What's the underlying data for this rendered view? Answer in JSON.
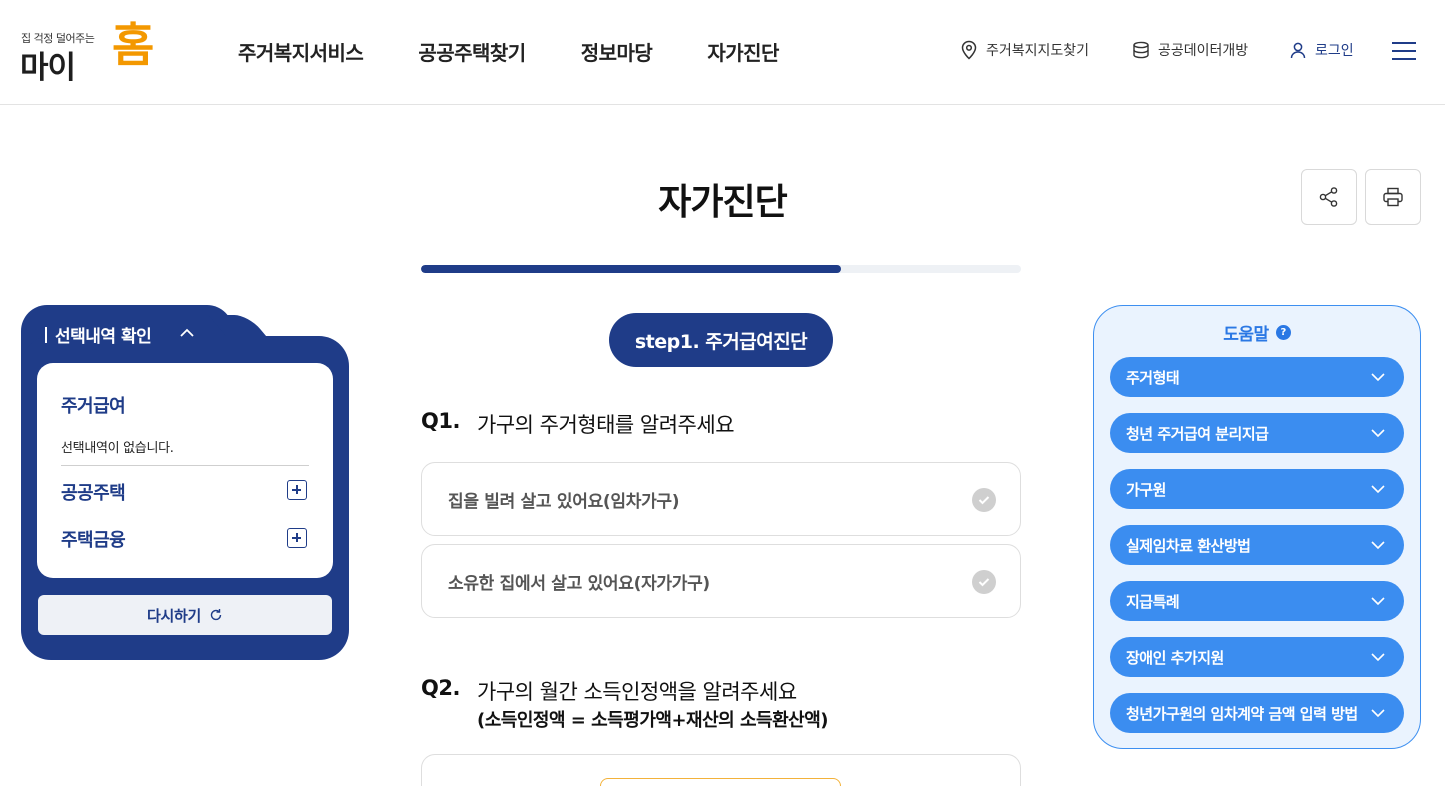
{
  "header": {
    "logo_tagline": "집 걱정 덜어주는",
    "logo_name": "마이",
    "logo_home": "홈",
    "nav": [
      "주거복지서비스",
      "공공주택찾기",
      "정보마당",
      "자가진단"
    ],
    "util_map": "주거복지지도찾기",
    "util_data": "공공데이터개방",
    "util_login": "로그인"
  },
  "page": {
    "title": "자가진단",
    "progress_percent": 70
  },
  "step": {
    "badge": "step1. 주거급여진단"
  },
  "questions": {
    "q1_num": "Q1.",
    "q1_text": "가구의 주거형태를 알려주세요",
    "q1_options": [
      "집을 빌려 살고 있어요(임차가구)",
      "소유한 집에서 살고 있어요(자가가구)"
    ],
    "q2_num": "Q2.",
    "q2_text": "가구의 월간 소득인정액을 알려주세요",
    "q2_sub": "(소득인정액 = 소득평가액+재산의 소득환산액)"
  },
  "selection": {
    "title": "선택내역 확인",
    "item1": "주거급여",
    "empty_text": "선택내역이 없습니다.",
    "item2": "공공주택",
    "item3": "주택금융",
    "reset": "다시하기"
  },
  "help": {
    "title": "도움말",
    "items": [
      "주거형태",
      "청년 주거급여 분리지급",
      "가구원",
      "실제임차료 환산방법",
      "지급특례",
      "장애인 추가지원",
      "청년가구원의 임차계약 금액 입력 방법"
    ]
  },
  "colors": {
    "primary": "#1f3c88",
    "help_accent": "#3b8df0",
    "logo_orange": "#f39800"
  }
}
